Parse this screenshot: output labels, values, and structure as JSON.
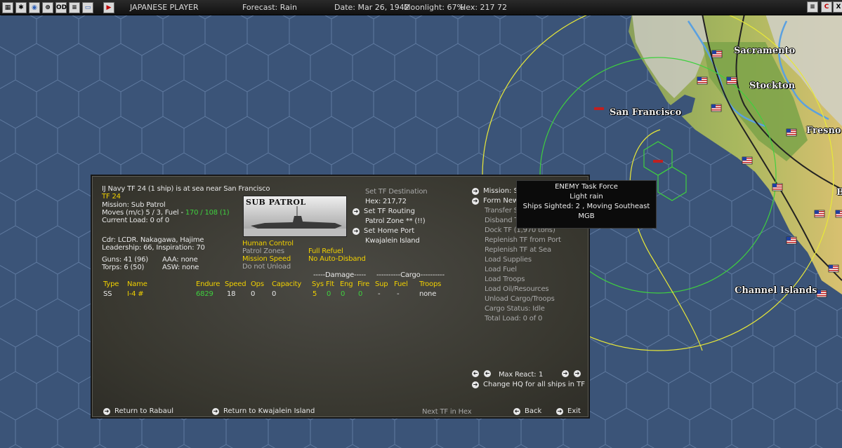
{
  "topbar": {
    "side": "JAPANESE PLAYER",
    "forecast": "Forecast: Rain",
    "date": "Date: Mar 26, 1942",
    "moonlight": "Moonlight: 67%",
    "hex": "Hex: 217 72",
    "od_label": "OD",
    "c_label": "C",
    "x_label": "X"
  },
  "map": {
    "cities": [
      "Sacramento",
      "Stockton",
      "San Francisco",
      "Fresno",
      "Channel Islands",
      "B"
    ]
  },
  "tooltip": {
    "title": "ENEMY Task Force",
    "weather": "Light rain",
    "sighting": "Ships Sighted: 2 , Moving Southeast",
    "type": "MGB"
  },
  "tf": {
    "header": "IJ Navy TF 24 (1 ship) is at sea near San Francisco",
    "name": "TF 24",
    "mission": "Mission: Sub Patrol",
    "moves_label": "Moves (m/c) 5 / 3, Fuel - ",
    "fuel_value": "170 / 108 (1)",
    "current_load": "Current Load: 0 of 0",
    "commander": "Cdr: LCDR. Nakagawa, Hajime",
    "leadership": "Leadership: 66, Inspiration: 70",
    "guns": "Guns: 41 (96)",
    "aaa": "AAA: none",
    "torps": "Torps: 6 (50)",
    "asw": "ASW: none",
    "image_label": "SUB PATROL"
  },
  "controls": {
    "human_control": "Human Control",
    "patrol_zones": "Patrol Zones",
    "full_refuel": "Full Refuel",
    "mission_speed": "Mission Speed",
    "no_auto_disband": "No Auto-Disband",
    "do_not_unload": "Do not Unload"
  },
  "destination": {
    "set_dest": "Set TF Destination",
    "hex": "Hex: 217,72",
    "set_routing": "Set TF Routing",
    "patrol_zone": "Patrol Zone ** (!!)",
    "set_home_port": "Set Home Port",
    "home_port": "Kwajalein Island"
  },
  "menu": {
    "mission": "Mission: Sub Patrol",
    "form_new": "Form New TF",
    "transfer": "Transfer Ships to TF",
    "disband": "Disband TF",
    "dock": "Dock TF (1,970 tons)",
    "replenish_port": "Replenish TF from Port",
    "replenish_sea": "Replenish TF at Sea",
    "load_supplies": "Load Supplies",
    "load_fuel": "Load Fuel",
    "load_troops": "Load Troops",
    "load_oil": "Load Oil/Resources",
    "unload": "Unload Cargo/Troops",
    "cargo_status": "Cargo Status: Idle",
    "total_load": "Total Load: 0 of 0"
  },
  "table": {
    "damage_header": "-----Damage-----",
    "cargo_header": "----------Cargo----------",
    "columns": [
      "Type",
      "Name",
      "Endure",
      "Speed",
      "Ops",
      "Capacity",
      "Sys",
      "Flt",
      "Eng",
      "Fire",
      "Sup",
      "Fuel",
      "Troops"
    ],
    "rows": [
      {
        "type": "SS",
        "name": "I-4 #",
        "endure": "6829",
        "speed": "18",
        "ops": "0",
        "capacity": "0",
        "sys": "5",
        "flt": "0",
        "eng": "0",
        "fire": "0",
        "sup": "-",
        "fuel": "-",
        "troops": "none"
      }
    ]
  },
  "react": {
    "label": "Max React:",
    "value": "1",
    "change_hq": "Change HQ for all ships in TF"
  },
  "bottom": {
    "return_rabaul": "Return to Rabaul",
    "return_kwajalein": "Return to Kwajalein Island",
    "next_tf": "Next TF in Hex",
    "back": "Back",
    "exit": "Exit"
  }
}
